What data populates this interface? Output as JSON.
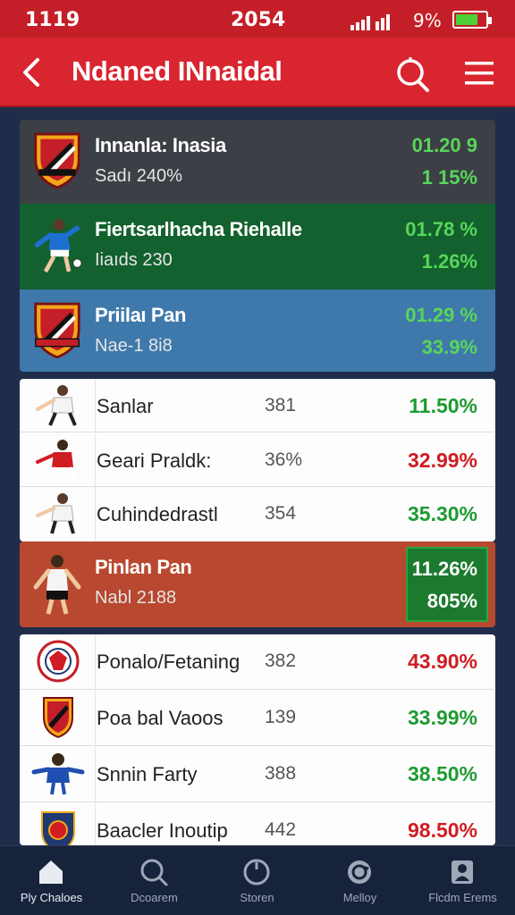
{
  "status_bar": {
    "time": "1119",
    "center": "2054",
    "battery": "9%"
  },
  "app_bar": {
    "title": "Ndaned INnaidal"
  },
  "featured": [
    {
      "name": "Innanla: Inasia",
      "sub": "Sadı 240%",
      "value_a": "01.20 9",
      "value_b": "1 15%",
      "logo": "club-crest-icon"
    },
    {
      "name": "Fiertsarlhacha Riehalle",
      "sub": "Iiaıds 230",
      "value_a": "01.78 %",
      "value_b": "1.26%",
      "logo": "player-icon"
    },
    {
      "name": "Priilaı Pan",
      "sub": "Nae-1 8i8",
      "value_a": "01.29 %",
      "value_b": "33.9%",
      "logo": "club-crest-icon"
    }
  ],
  "list_a": [
    {
      "name": "Sanlar",
      "num": "381",
      "pct": "11.50%",
      "trend": "pos"
    },
    {
      "name": "Geari Praldk:",
      "num": "36%",
      "pct": "32.99%",
      "trend": "neg"
    },
    {
      "name": "Cuhindedrastl",
      "num": "354",
      "pct": "35.30%",
      "trend": "pos"
    }
  ],
  "highlight": {
    "name": "Pinlan Pan",
    "sub": "Nabl 2188",
    "value_a": "11.26%",
    "value_b": "805%"
  },
  "list_b": [
    {
      "name": "Ponalo/Fetaning",
      "num": "382",
      "pct": "43.90%",
      "trend": "neg",
      "logo": "club-badge-icon"
    },
    {
      "name": "Poa bal Vaoos",
      "num": "139",
      "pct": "33.99%",
      "trend": "pos",
      "logo": "club-crest-icon"
    },
    {
      "name": "Snnin Farty",
      "num": "388",
      "pct": "38.50%",
      "trend": "pos",
      "logo": "player-icon"
    },
    {
      "name": "Baacler Inoutip",
      "num": "442",
      "pct": "98.50%",
      "trend": "neg",
      "logo": "club-crest-icon"
    }
  ],
  "nav": [
    {
      "label": "Ply Chaloes",
      "icon": "home-icon"
    },
    {
      "label": "Dcoarem",
      "icon": "search-icon"
    },
    {
      "label": "Storen",
      "icon": "circle-icon"
    },
    {
      "label": "Melloy",
      "icon": "refresh-icon"
    },
    {
      "label": "Flcdm Erems",
      "icon": "profile-icon"
    }
  ],
  "colors": {
    "primary_red": "#d9252f",
    "positive_green": "#1e9b32",
    "negative_red": "#d01c23",
    "background": "#1f2d4a"
  }
}
